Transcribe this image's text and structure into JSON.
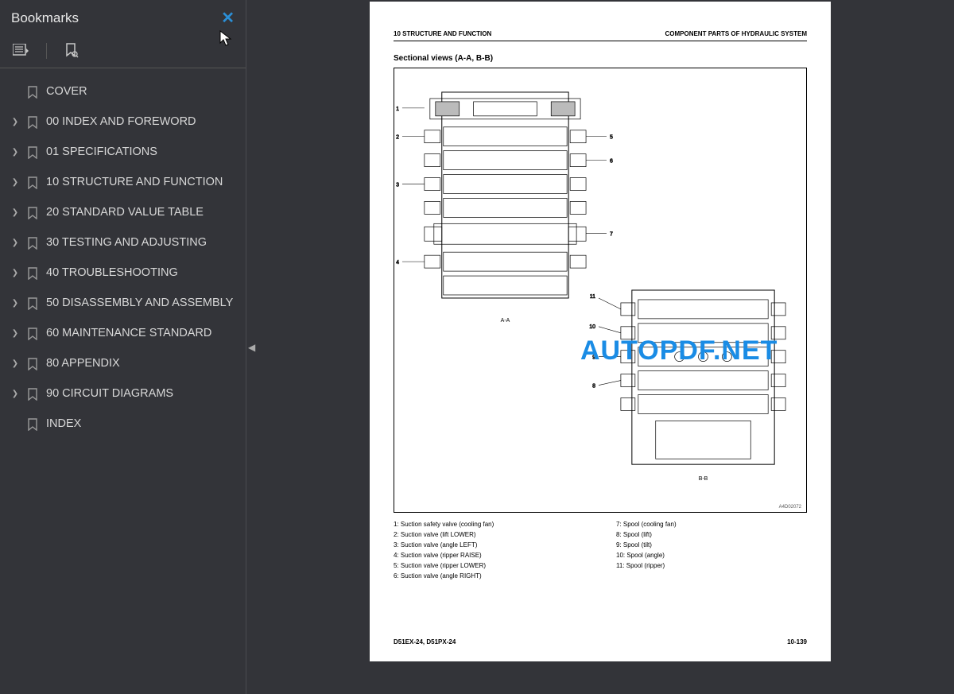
{
  "sidebar": {
    "title": "Bookmarks",
    "items": [
      {
        "label": "COVER",
        "expandable": false
      },
      {
        "label": "00 INDEX AND FOREWORD",
        "expandable": true
      },
      {
        "label": "01 SPECIFICATIONS",
        "expandable": true
      },
      {
        "label": "10 STRUCTURE AND FUNCTION",
        "expandable": true
      },
      {
        "label": "20 STANDARD VALUE TABLE",
        "expandable": true
      },
      {
        "label": "30 TESTING AND ADJUSTING",
        "expandable": true
      },
      {
        "label": "40 TROUBLESHOOTING",
        "expandable": true
      },
      {
        "label": "50 DISASSEMBLY AND ASSEMBLY",
        "expandable": true
      },
      {
        "label": "60 MAINTENANCE STANDARD",
        "expandable": true
      },
      {
        "label": "80 APPENDIX",
        "expandable": true
      },
      {
        "label": "90 CIRCUIT DIAGRAMS",
        "expandable": true
      },
      {
        "label": "INDEX",
        "expandable": false
      }
    ]
  },
  "page": {
    "header_left": "10 STRUCTURE AND FUNCTION",
    "header_right": "COMPONENT PARTS OF HYDRAULIC SYSTEM",
    "section_title": "Sectional views (A-A, B-B)",
    "view_a_label": "A-A",
    "view_b_label": "B-B",
    "figure_id": "A4D02072",
    "callouts_a": [
      "1",
      "2",
      "3",
      "4",
      "5",
      "6",
      "7"
    ],
    "callouts_b": [
      "8",
      "9",
      "10",
      "11"
    ],
    "legend_left": [
      "1: Suction safety valve (cooling fan)",
      "2: Suction valve (lift LOWER)",
      "3: Suction valve (angle LEFT)",
      "4: Suction valve (ripper RAISE)",
      "5: Suction valve (ripper LOWER)",
      "6: Suction valve (angle RIGHT)"
    ],
    "legend_right": [
      "7: Spool (cooling fan)",
      "8: Spool (lift)",
      "9: Spool (tilt)",
      "10: Spool (angle)",
      "11: Spool (ripper)"
    ],
    "footer_left": "D51EX-24, D51PX-24",
    "footer_right": "10-139"
  },
  "watermark": "AUTOPDF.NET"
}
